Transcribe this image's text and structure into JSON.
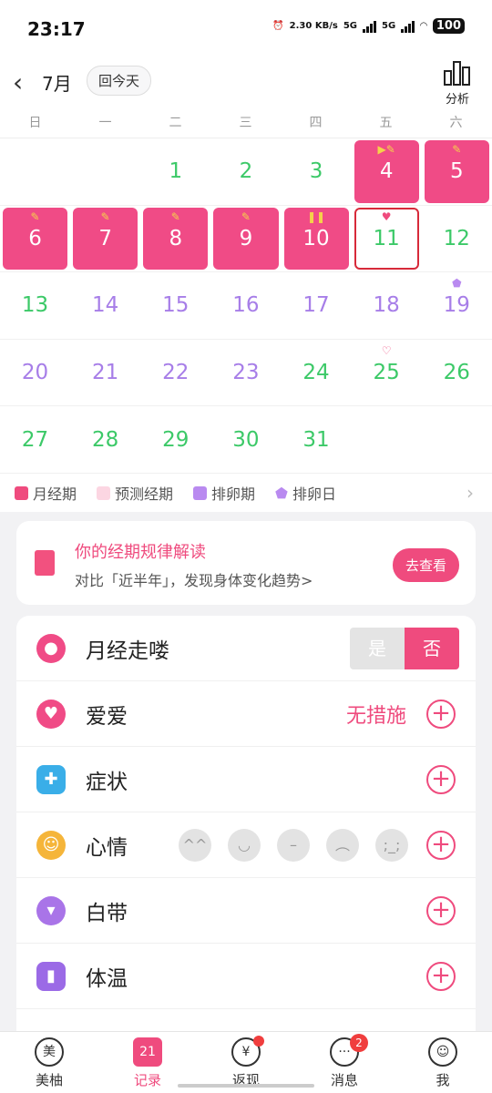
{
  "status": {
    "time": "23:17",
    "net_speed": "2.30 KB/s",
    "sig1": "5G",
    "sig2": "5G",
    "battery": "100"
  },
  "header": {
    "month": "7月",
    "today_button": "回今天",
    "analysis_label": "分析"
  },
  "weekdays": [
    "日",
    "一",
    "二",
    "三",
    "四",
    "五",
    "六"
  ],
  "calendar": {
    "rows": [
      [
        {
          "day": "",
          "type": "empty"
        },
        {
          "day": "",
          "type": "empty"
        },
        {
          "day": "1",
          "type": "green"
        },
        {
          "day": "2",
          "type": "green"
        },
        {
          "day": "3",
          "type": "green"
        },
        {
          "day": "4",
          "type": "period",
          "mark": "▶✎"
        },
        {
          "day": "5",
          "type": "period",
          "mark": "✎"
        }
      ],
      [
        {
          "day": "6",
          "type": "period",
          "mark": "✎"
        },
        {
          "day": "7",
          "type": "period",
          "mark": "✎"
        },
        {
          "day": "8",
          "type": "period",
          "mark": "✎"
        },
        {
          "day": "9",
          "type": "period",
          "mark": "✎"
        },
        {
          "day": "10",
          "type": "period",
          "mark": "❚❚"
        },
        {
          "day": "11",
          "type": "today",
          "mark": "♥"
        },
        {
          "day": "12",
          "type": "green"
        }
      ],
      [
        {
          "day": "13",
          "type": "green"
        },
        {
          "day": "14",
          "type": "purple"
        },
        {
          "day": "15",
          "type": "purple"
        },
        {
          "day": "16",
          "type": "purple"
        },
        {
          "day": "17",
          "type": "purple"
        },
        {
          "day": "18",
          "type": "purple"
        },
        {
          "day": "19",
          "type": "purple",
          "mark": "⬟"
        }
      ],
      [
        {
          "day": "20",
          "type": "purple"
        },
        {
          "day": "21",
          "type": "purple"
        },
        {
          "day": "22",
          "type": "purple"
        },
        {
          "day": "23",
          "type": "purple"
        },
        {
          "day": "24",
          "type": "green"
        },
        {
          "day": "25",
          "type": "green",
          "mark": "♡"
        },
        {
          "day": "26",
          "type": "green"
        }
      ],
      [
        {
          "day": "27",
          "type": "green"
        },
        {
          "day": "28",
          "type": "green"
        },
        {
          "day": "29",
          "type": "green"
        },
        {
          "day": "30",
          "type": "green"
        },
        {
          "day": "31",
          "type": "green"
        },
        {
          "day": "",
          "type": "empty"
        },
        {
          "day": "",
          "type": "empty"
        }
      ]
    ]
  },
  "legend": [
    {
      "label": "月经期",
      "color": "#ef4b7e"
    },
    {
      "label": "预测经期",
      "color": "#fcd6e2"
    },
    {
      "label": "排卵期",
      "color": "#b98af0"
    },
    {
      "label": "排卵日",
      "color": "#b98af0"
    }
  ],
  "insight": {
    "title": "你的经期规律解读",
    "subtitle": "对比「近半年」，发现身体变化趋势>",
    "button": "去查看"
  },
  "records": {
    "period": {
      "label": "月经走喽",
      "yes": "是",
      "no": "否"
    },
    "love": {
      "label": "爱爱",
      "value": "无措施"
    },
    "symptom": {
      "label": "症状"
    },
    "mood": {
      "label": "心情"
    },
    "discharge": {
      "label": "白带"
    },
    "temperature": {
      "label": "体温"
    }
  },
  "tabbar": {
    "items": [
      {
        "label": "美柚",
        "icon": "美"
      },
      {
        "label": "记录",
        "icon": "21"
      },
      {
        "label": "返现",
        "icon": "¥"
      },
      {
        "label": "消息",
        "icon": "···",
        "badge": "2"
      },
      {
        "label": "我",
        "icon": "☺"
      }
    ]
  },
  "colors": {
    "accent": "#ef4b7e",
    "green": "#3cc968",
    "purple": "#a77ee8"
  }
}
